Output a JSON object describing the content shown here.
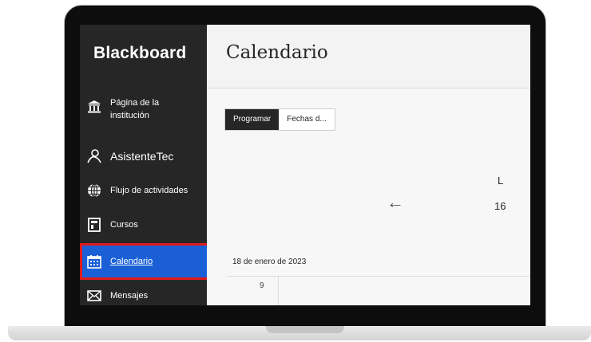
{
  "app": {
    "logo": "Blackboard"
  },
  "sidebar": {
    "items": [
      {
        "label": "Página de la institución",
        "icon": "institution-icon"
      },
      {
        "label": "AsistenteTec",
        "icon": "user-icon"
      },
      {
        "label": "Flujo de actividades",
        "icon": "globe-icon"
      },
      {
        "label": "Cursos",
        "icon": "courses-icon"
      },
      {
        "label": "Calendario",
        "icon": "calendar-icon",
        "active": true
      },
      {
        "label": "Mensajes",
        "icon": "mail-icon"
      }
    ]
  },
  "main": {
    "title": "Calendario",
    "view_toggle": {
      "options": [
        "Programar",
        "Fechas d..."
      ],
      "selected": "Programar"
    },
    "day": {
      "letter": "L",
      "number": "16"
    },
    "date_label": "18 de enero de 2023",
    "hour": "9"
  },
  "colors": {
    "sidebar": "#262626",
    "active": "#1a5fd6",
    "highlight": "#e01a1a"
  }
}
